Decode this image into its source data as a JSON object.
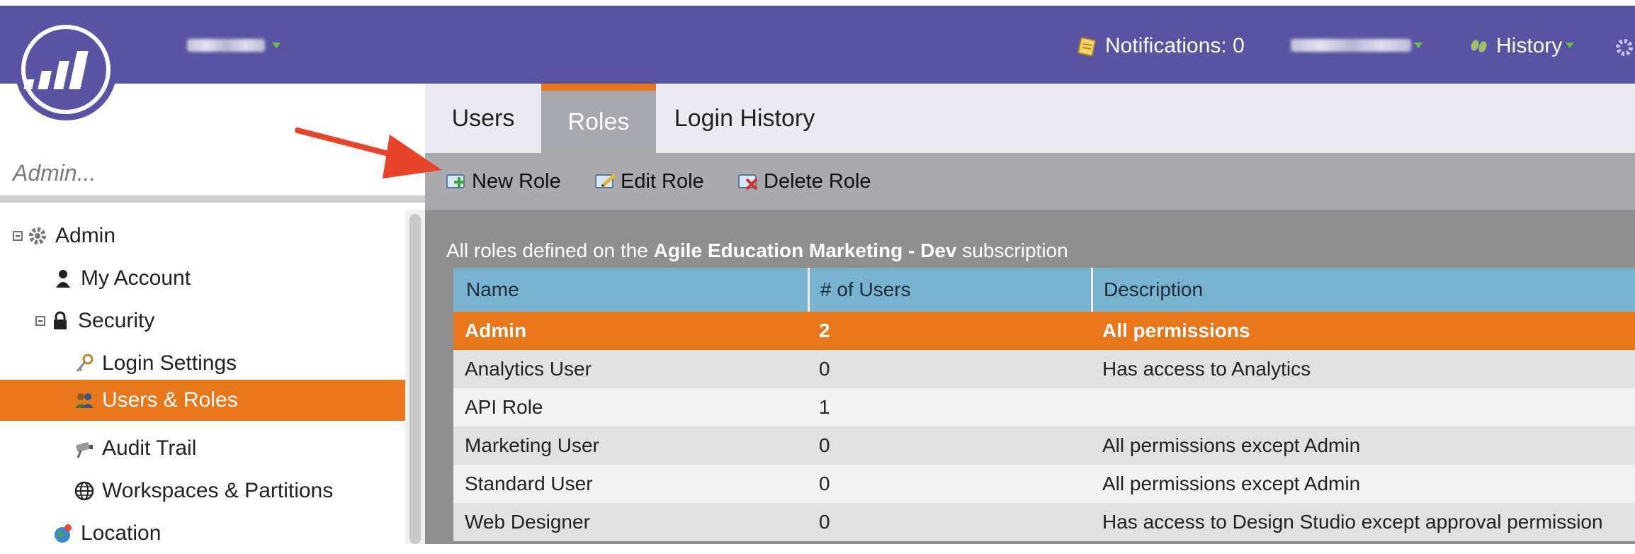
{
  "header": {
    "workspace_blurred": "",
    "notifications_label": "Notifications: 0",
    "user_blurred": "",
    "history_label": "History"
  },
  "sidebar": {
    "search_placeholder": "Admin...",
    "tree": [
      {
        "label": "Admin",
        "icon": "gear-icon"
      },
      {
        "label": "My Account",
        "icon": "person-icon"
      },
      {
        "label": "Security",
        "icon": "lock-icon"
      },
      {
        "label": "Login Settings",
        "icon": "key-icon"
      },
      {
        "label": "Users & Roles",
        "icon": "users-icon"
      },
      {
        "label": "Audit Trail",
        "icon": "camera-icon"
      },
      {
        "label": "Workspaces & Partitions",
        "icon": "globe-icon"
      },
      {
        "label": "Location",
        "icon": "location-globe-icon"
      }
    ]
  },
  "tabs": [
    {
      "label": "Users"
    },
    {
      "label": "Roles"
    },
    {
      "label": "Login History"
    }
  ],
  "toolbar": {
    "new_role": "New Role",
    "edit_role": "Edit Role",
    "delete_role": "Delete Role"
  },
  "content": {
    "subtitle_prefix": "All roles defined on the ",
    "subscription_name": "Agile Education Marketing - Dev",
    "subtitle_suffix": " subscription"
  },
  "table": {
    "headers": [
      "Name",
      "# of Users",
      "Description"
    ],
    "rows": [
      {
        "name": "Admin",
        "users": "2",
        "description": "All permissions"
      },
      {
        "name": "Analytics User",
        "users": "0",
        "description": "Has access to Analytics"
      },
      {
        "name": "API Role",
        "users": "1",
        "description": ""
      },
      {
        "name": "Marketing User",
        "users": "0",
        "description": "All permissions except Admin"
      },
      {
        "name": "Standard User",
        "users": "0",
        "description": "All permissions except Admin"
      },
      {
        "name": "Web Designer",
        "users": "0",
        "description": "Has access to Design Studio except approval permission"
      }
    ]
  },
  "colors": {
    "header_bg": "#5a53a4",
    "accent_orange": "#e8761a",
    "table_header": "#78b3d0",
    "annotation_arrow": "#e8442a"
  }
}
